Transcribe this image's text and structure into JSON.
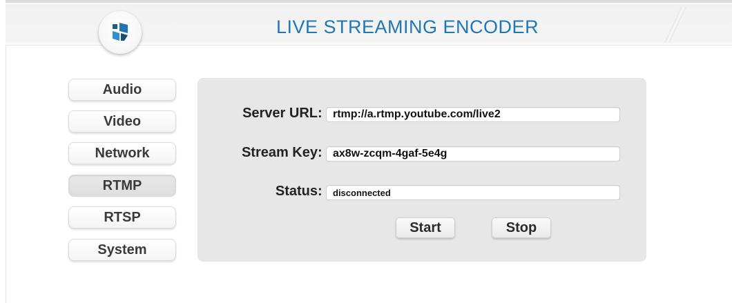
{
  "header": {
    "title": "LIVE STREAMING ENCODER",
    "logo_icon": "cube-logo-icon",
    "accent_color": "#1f78b4"
  },
  "sidebar": {
    "items": [
      {
        "label": "Audio",
        "active": false
      },
      {
        "label": "Video",
        "active": false
      },
      {
        "label": "Network",
        "active": false
      },
      {
        "label": "RTMP",
        "active": true
      },
      {
        "label": "RTSP",
        "active": false
      },
      {
        "label": "System",
        "active": false
      }
    ]
  },
  "rtmp": {
    "server_url": {
      "label": "Server URL",
      "separator": ":",
      "value": "rtmp://a.rtmp.youtube.com/live2"
    },
    "stream_key": {
      "label": "Stream Key",
      "separator": ":",
      "value": "ax8w-zcqm-4gaf-5e4g"
    },
    "status": {
      "label": "Status",
      "separator": ":",
      "value": "disconnected"
    },
    "start_label": "Start",
    "stop_label": "Stop"
  }
}
